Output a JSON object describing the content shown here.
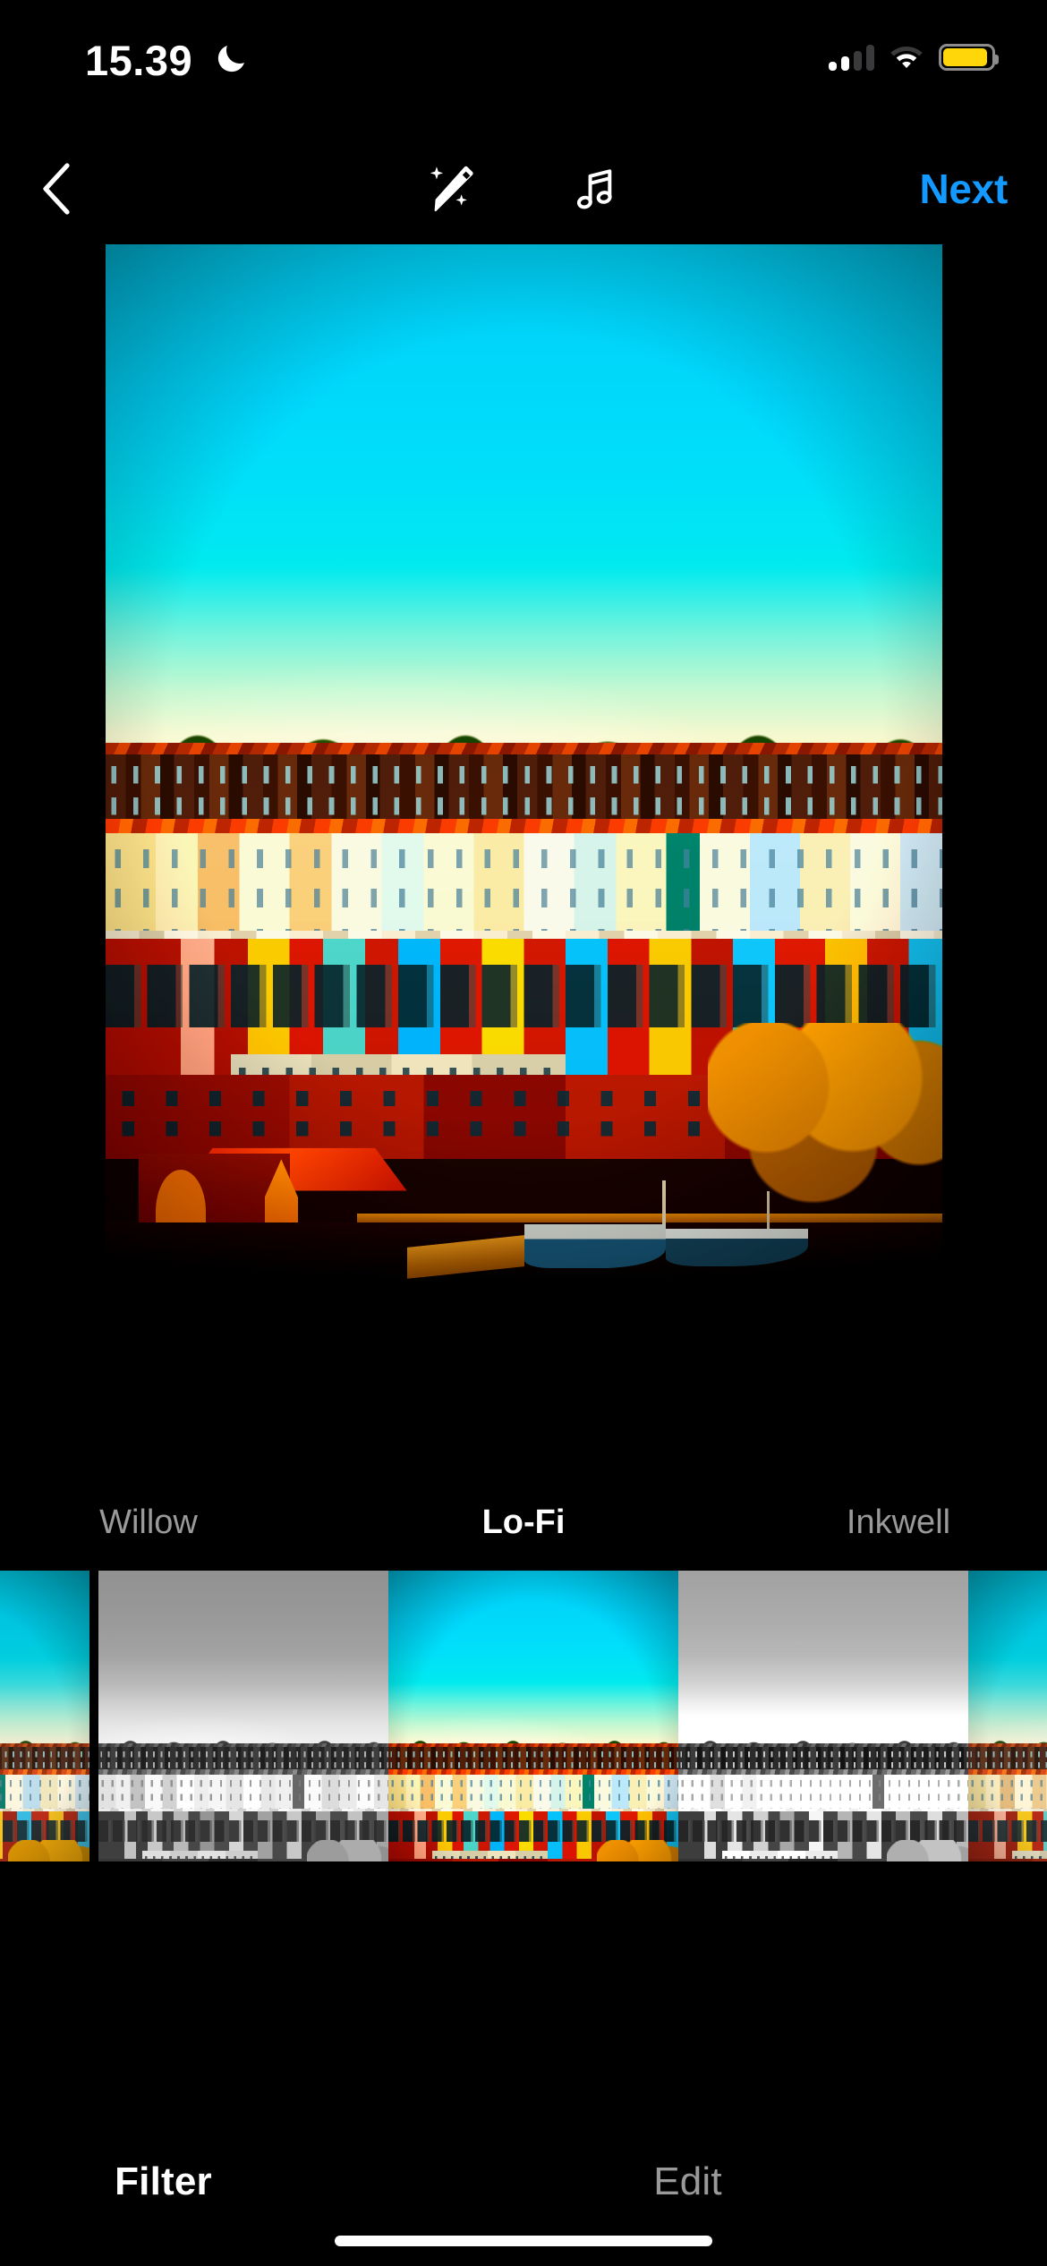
{
  "status_bar": {
    "time": "15.39",
    "dnd_icon": "crescent-moon-icon",
    "cellular": {
      "icon": "cellular-signal-icon",
      "bars_total": 4,
      "bars_filled": 2
    },
    "wifi": {
      "icon": "wifi-icon",
      "arcs_total": 3,
      "arcs_filled": 2
    },
    "battery": {
      "icon": "battery-icon",
      "fill_color": "#FFD60A",
      "level_percent": 92,
      "low_power_mode": true
    }
  },
  "nav_bar": {
    "back_icon": "chevron-left-icon",
    "magic_icon": "magic-wand-icon",
    "music_icon": "music-note-icon",
    "next_label": "Next",
    "next_color": "#1399FF"
  },
  "preview": {
    "alt_name": "bristol-harbourside-colourful-houses-photo",
    "applied_filter": "Lo-Fi",
    "sky_top_color": "#03B6CD",
    "sky_horizon_color": "#EEE9CF"
  },
  "filter_carousel": {
    "selected_index": 2,
    "visible_labels": [
      {
        "label": "Willow",
        "selected": false,
        "color": "#9a9a9a"
      },
      {
        "label": "Lo-Fi",
        "selected": true,
        "color": "#ffffff"
      },
      {
        "label": "Inkwell",
        "selected": false,
        "color": "#9a9a9a"
      }
    ],
    "thumbnails": [
      {
        "name": "filter-thumb-partial-left",
        "filter": "normal",
        "selected": false
      },
      {
        "name": "filter-thumb-willow",
        "filter": "willow",
        "selected": false
      },
      {
        "name": "filter-thumb-lofi",
        "filter": "lofi",
        "selected": true
      },
      {
        "name": "filter-thumb-inkwell",
        "filter": "inkwell",
        "selected": false
      },
      {
        "name": "filter-thumb-partial-right",
        "filter": "normal",
        "selected": false
      }
    ]
  },
  "bottom_tabs": {
    "selected": "Filter",
    "items": [
      {
        "label": "Filter",
        "selected": true,
        "color": "#ffffff"
      },
      {
        "label": "Edit",
        "selected": false,
        "color": "#9a9a9a"
      }
    ]
  },
  "home_indicator": {
    "name": "home-indicator",
    "color": "#ffffff"
  }
}
